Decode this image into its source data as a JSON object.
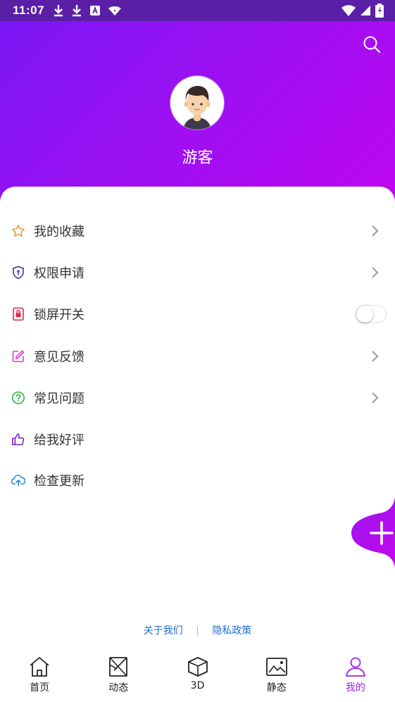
{
  "status_bar": {
    "time": "11:07",
    "left_icons": [
      "download-icon",
      "download-icon",
      "app-a-icon",
      "wifi-icon"
    ],
    "right_icons": [
      "wifi-icon",
      "signal-icon",
      "battery-icon"
    ]
  },
  "profile": {
    "username": "游客"
  },
  "menu": {
    "items": [
      {
        "label": "我的收藏",
        "icon": "star-icon",
        "color": "#e6a23c",
        "trailing": "chevron"
      },
      {
        "label": "权限申请",
        "icon": "shield-icon",
        "color": "#2b3a9e",
        "trailing": "chevron"
      },
      {
        "label": "锁屏开关",
        "icon": "lock-screen-icon",
        "color": "#e0264a",
        "trailing": "toggle"
      },
      {
        "label": "意见反馈",
        "icon": "edit-icon",
        "color": "#d53fd3",
        "trailing": "chevron"
      },
      {
        "label": "常见问题",
        "icon": "question-icon",
        "color": "#2fb34a",
        "trailing": "chevron"
      },
      {
        "label": "给我好评",
        "icon": "thumbs-up-icon",
        "color": "#7e22c8",
        "trailing": "none"
      },
      {
        "label": "检查更新",
        "icon": "cloud-upload-icon",
        "color": "#2a8fd6",
        "trailing": "none"
      }
    ]
  },
  "footer": {
    "about": "关于我们",
    "separator": "|",
    "privacy": "隐私政策"
  },
  "bottom_nav": {
    "items": [
      {
        "label": "首页",
        "icon": "home-icon"
      },
      {
        "label": "动态",
        "icon": "dynamic-icon"
      },
      {
        "label": "3D",
        "icon": "cube-icon"
      },
      {
        "label": "静态",
        "icon": "image-icon"
      },
      {
        "label": "我的",
        "icon": "person-icon",
        "active": true
      }
    ]
  },
  "colors": {
    "header_start": "#7b17f5",
    "header_end": "#bf06ef",
    "accent": "#a020f0",
    "link": "#1f6fc7"
  }
}
